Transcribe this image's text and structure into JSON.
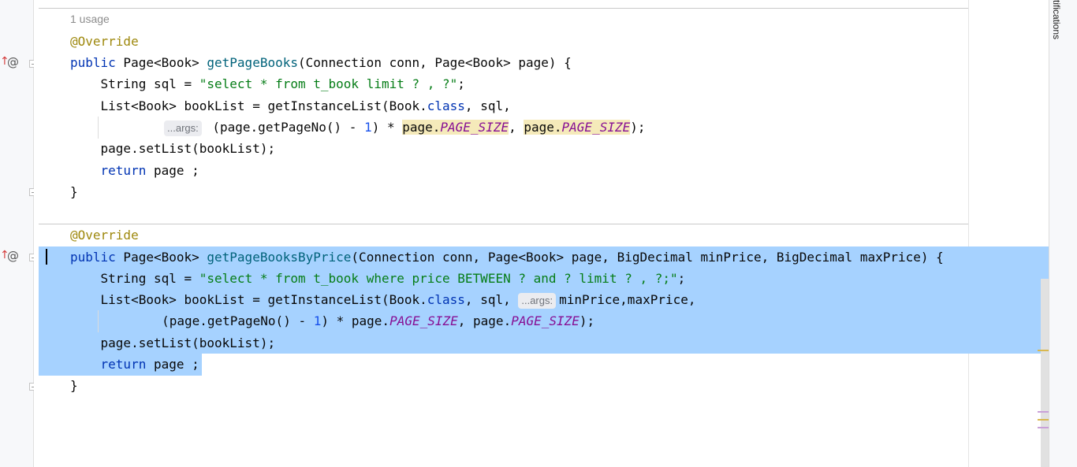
{
  "code": {
    "usage_hint": "1 usage",
    "m1_annotation": "@Override",
    "m1_sig_kw": "public",
    "m1_sig_type": " Page<Book> ",
    "m1_sig_name": "getPageBooks",
    "m1_sig_params": "(Connection conn, Page<Book> page) {",
    "m1_sql_prefix": "    String sql = ",
    "m1_sql_str": "\"select * from t_book limit ? , ?\"",
    "m1_sql_suffix": ";",
    "m1_list_prefix": "    List<Book> bookList = getInstanceList(Book.",
    "m1_list_class": "class",
    "m1_list_suffix": ", sql,",
    "m1_args_hint": "...args:",
    "m1_args_open": " (page.getPageNo() - ",
    "m1_args_num": "1",
    "m1_args_mul": ") * ",
    "m1_args_page1": "page.",
    "m1_args_const1": "PAGE_SIZE",
    "m1_args_comma": ", ",
    "m1_args_page2": "page.",
    "m1_args_const2": "PAGE_SIZE",
    "m1_args_end": ");",
    "m1_setlist": "    page.setList(bookList);",
    "m1_return_kw": "    return",
    "m1_return_rest": " page ;",
    "m1_close": "}",
    "m2_annotation": "@Override",
    "m2_sig_kw": "public",
    "m2_sig_type": " Page<Book> ",
    "m2_sig_name": "getPageBooksByPrice",
    "m2_sig_params": "(Connection conn, Page<Book> page, BigDecimal minPrice, BigDecimal maxPrice) {",
    "m2_sql_prefix": "    String sql = ",
    "m2_sql_str": "\"select * from t_book where price BETWEEN ? and ? limit ? , ?;\"",
    "m2_sql_suffix": ";",
    "m2_list_prefix": "    List<Book> bookList = getInstanceList(Book.",
    "m2_list_class": "class",
    "m2_list_suffix": ", sql, ",
    "m2_args_hint": "...args:",
    "m2_list_tail": "minPrice,maxPrice,",
    "m2_args_open": "        (page.getPageNo() - ",
    "m2_args_num": "1",
    "m2_args_mul": ") * page.",
    "m2_args_const1": "PAGE_SIZE",
    "m2_args_mid": ", page.",
    "m2_args_const2": "PAGE_SIZE",
    "m2_args_end": ");",
    "m2_setlist": "    page.setList(bookList);",
    "m2_return_kw": "    return",
    "m2_return_rest": " page ;",
    "m2_close": "}"
  },
  "side_panel": {
    "notifications_label": "tifications"
  },
  "colors": {
    "selection": "#a6d2ff",
    "keyword": "#0033b3",
    "string": "#067d17",
    "annotation": "#9e880d",
    "constant": "#871094"
  }
}
